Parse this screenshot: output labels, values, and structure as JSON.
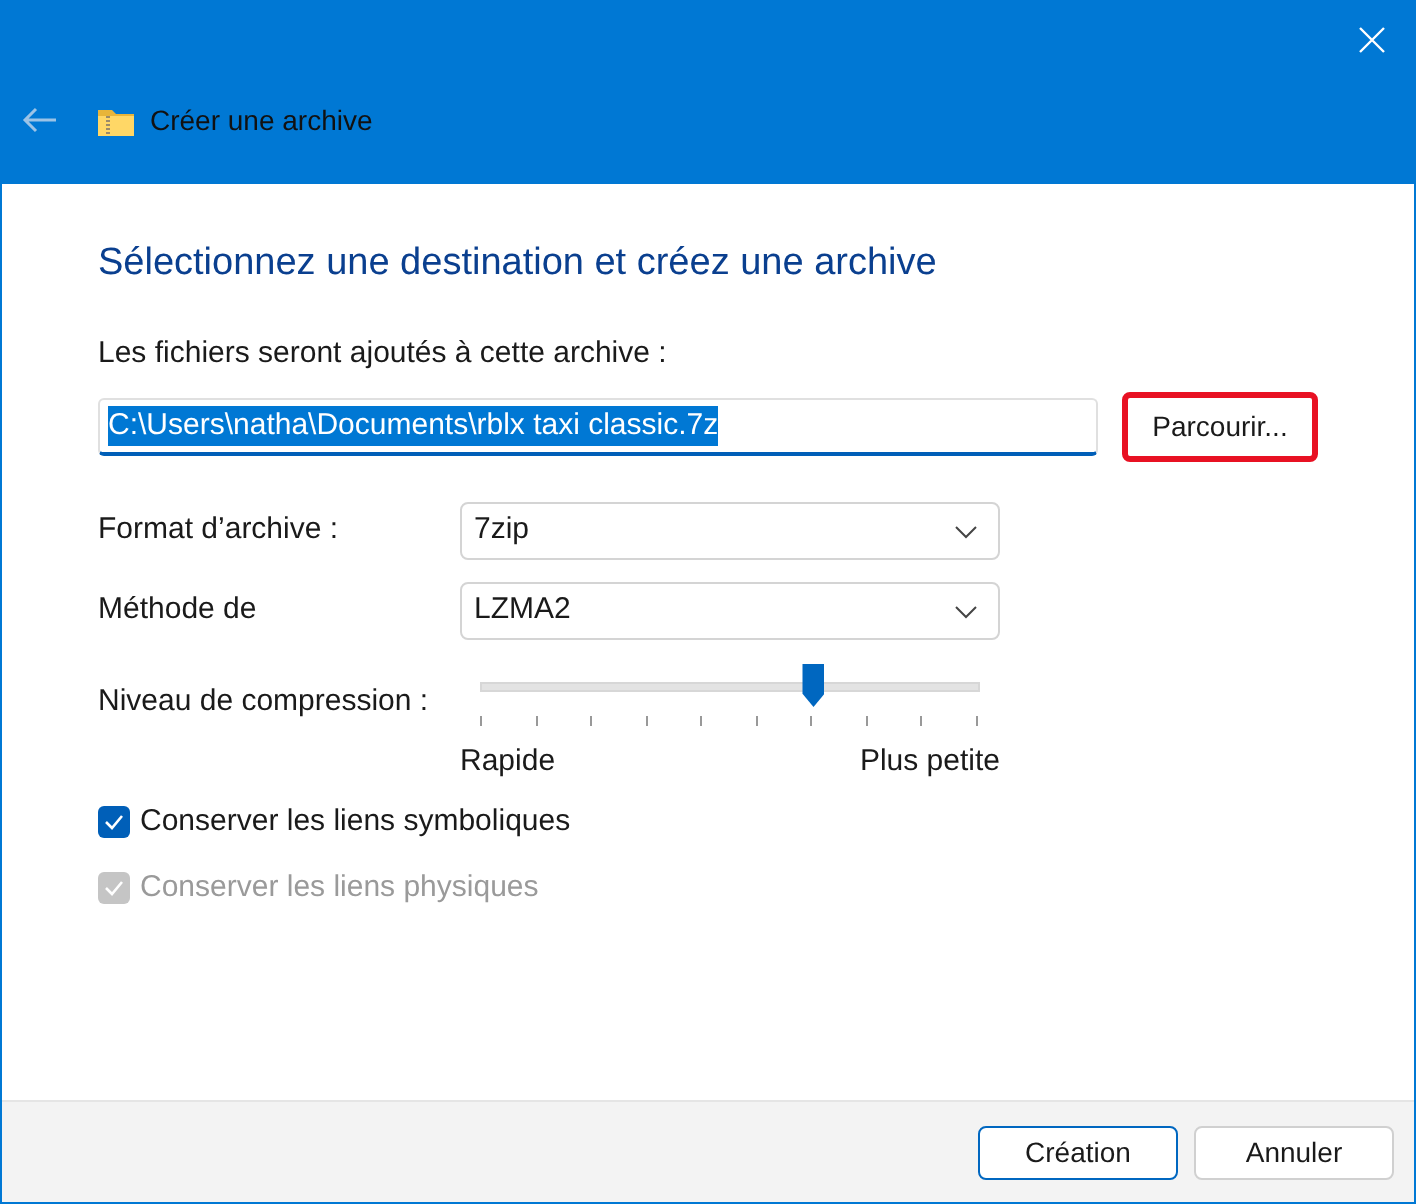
{
  "window": {
    "title": "Créer une archive"
  },
  "heading": "Sélectionnez une destination et créez une archive",
  "destination": {
    "label": "Les fichiers seront ajoutés à cette archive :",
    "value": "C:\\Users\\natha\\Documents\\rblx taxi classic.7z",
    "browse": "Parcourir..."
  },
  "format": {
    "label": "Format d’archive :",
    "value": "7zip"
  },
  "method": {
    "label": "Méthode de",
    "value": "LZMA2"
  },
  "compression": {
    "label": "Niveau de compression :",
    "level": 0.667,
    "min_label": "Rapide",
    "max_label": "Plus petite"
  },
  "options": [
    {
      "label": "Conserver les liens symboliques",
      "checked": true,
      "disabled": false
    },
    {
      "label": "Conserver les liens physiques",
      "checked": true,
      "disabled": true
    }
  ],
  "buttons": [
    {
      "label": "Création",
      "kind": "primary"
    },
    {
      "label": "Annuler",
      "kind": "secondary"
    }
  ]
}
